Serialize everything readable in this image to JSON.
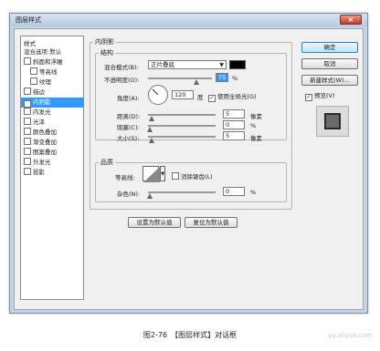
{
  "window": {
    "title": "图层样式",
    "close": "×"
  },
  "styles_panel": {
    "title": "样式",
    "items": [
      {
        "label": "混合选项:默认",
        "checkbox": false
      },
      {
        "label": "斜面和浮雕",
        "checkbox": true,
        "checked": false
      },
      {
        "label": "等高线",
        "checkbox": true,
        "checked": false,
        "indent": true
      },
      {
        "label": "纹理",
        "checkbox": true,
        "checked": false,
        "indent": true
      },
      {
        "label": "描边",
        "checkbox": true,
        "checked": false
      },
      {
        "label": "内阴影",
        "checkbox": true,
        "checked": true,
        "selected": true
      },
      {
        "label": "内发光",
        "checkbox": true,
        "checked": false
      },
      {
        "label": "光泽",
        "checkbox": true,
        "checked": false
      },
      {
        "label": "颜色叠加",
        "checkbox": true,
        "checked": false
      },
      {
        "label": "渐变叠加",
        "checkbox": true,
        "checked": false
      },
      {
        "label": "图案叠加",
        "checkbox": true,
        "checked": false
      },
      {
        "label": "外发光",
        "checkbox": true,
        "checked": false
      },
      {
        "label": "投影",
        "checkbox": true,
        "checked": false
      }
    ]
  },
  "inner_shadow": {
    "group_title": "内阴影",
    "structure_title": "结构",
    "blend_mode_label": "混合模式(B):",
    "blend_mode_value": "正片叠底",
    "shadow_color": "#000000",
    "opacity_label": "不透明度(O):",
    "opacity_value": "75",
    "opacity_unit": "%",
    "opacity_level": 0.75,
    "angle_label": "角度(A):",
    "angle_value": "120",
    "angle_unit": "度",
    "global_light_label": "使用全局光(G)",
    "global_light_checked": true,
    "distance_label": "距离(D):",
    "distance_value": "5",
    "distance_unit": "像素",
    "choke_label": "阻塞(C):",
    "choke_value": "0",
    "choke_unit": "%",
    "size_label": "大小(S):",
    "size_value": "5",
    "size_unit": "像素",
    "quality_title": "品质",
    "contour_label": "等高线:",
    "anti_alias_label": "消除锯齿(L)",
    "anti_alias_checked": false,
    "noise_label": "杂色(N):",
    "noise_value": "0",
    "noise_unit": "%",
    "set_default": "设置为默认值",
    "reset_default": "复位为默认值"
  },
  "right_panel": {
    "ok": "确定",
    "cancel": "取消",
    "new_style": "新建样式(W)...",
    "preview_label": "预览(V)",
    "preview_checked": true
  },
  "caption": "图2-76　【图层样式】对话框",
  "watermark": "yq.aliyun.com"
}
